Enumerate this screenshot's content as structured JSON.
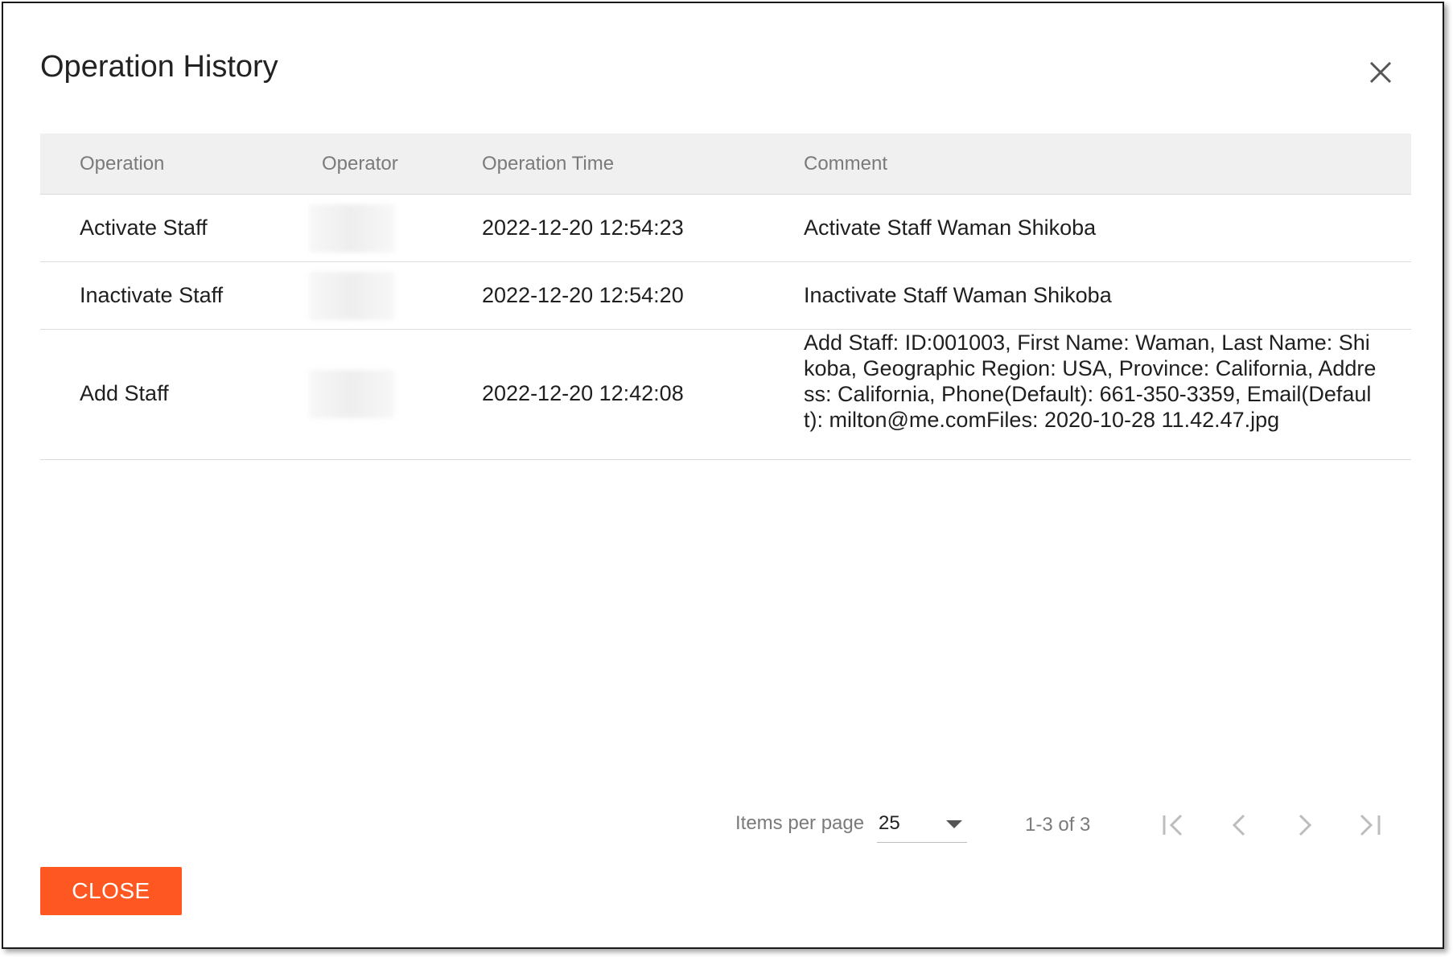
{
  "dialog": {
    "title": "Operation History",
    "close_icon": "close-icon"
  },
  "table": {
    "columns": [
      "Operation",
      "Operator",
      "Operation Time",
      "Comment"
    ],
    "rows": [
      {
        "operation": "Activate Staff",
        "operator": "",
        "time": "2022-12-20 12:54:23",
        "comment": "Activate Staff Waman Shikoba"
      },
      {
        "operation": "Inactivate Staff",
        "operator": "",
        "time": "2022-12-20 12:54:20",
        "comment": "Inactivate Staff Waman Shikoba"
      },
      {
        "operation": "Add Staff",
        "operator": "",
        "time": "2022-12-20 12:42:08",
        "comment": "Add Staff: ID:001003, First Name: Waman, Last Name: Shikoba, Geographic Region: USA, Province: California, Address: California, Phone(Default): 661-350-3359, Email(Default): milton@me.comFiles: 2020-10-28 11.42.47.jpg"
      }
    ]
  },
  "pagination": {
    "items_per_page_label": "Items per page",
    "items_per_page_value": "25",
    "range_text": "1-3 of 3",
    "icons": [
      "first-page-icon",
      "previous-page-icon",
      "next-page-icon",
      "last-page-icon"
    ]
  },
  "footer": {
    "close_label": "CLOSE",
    "close_color": "#ff5722"
  }
}
